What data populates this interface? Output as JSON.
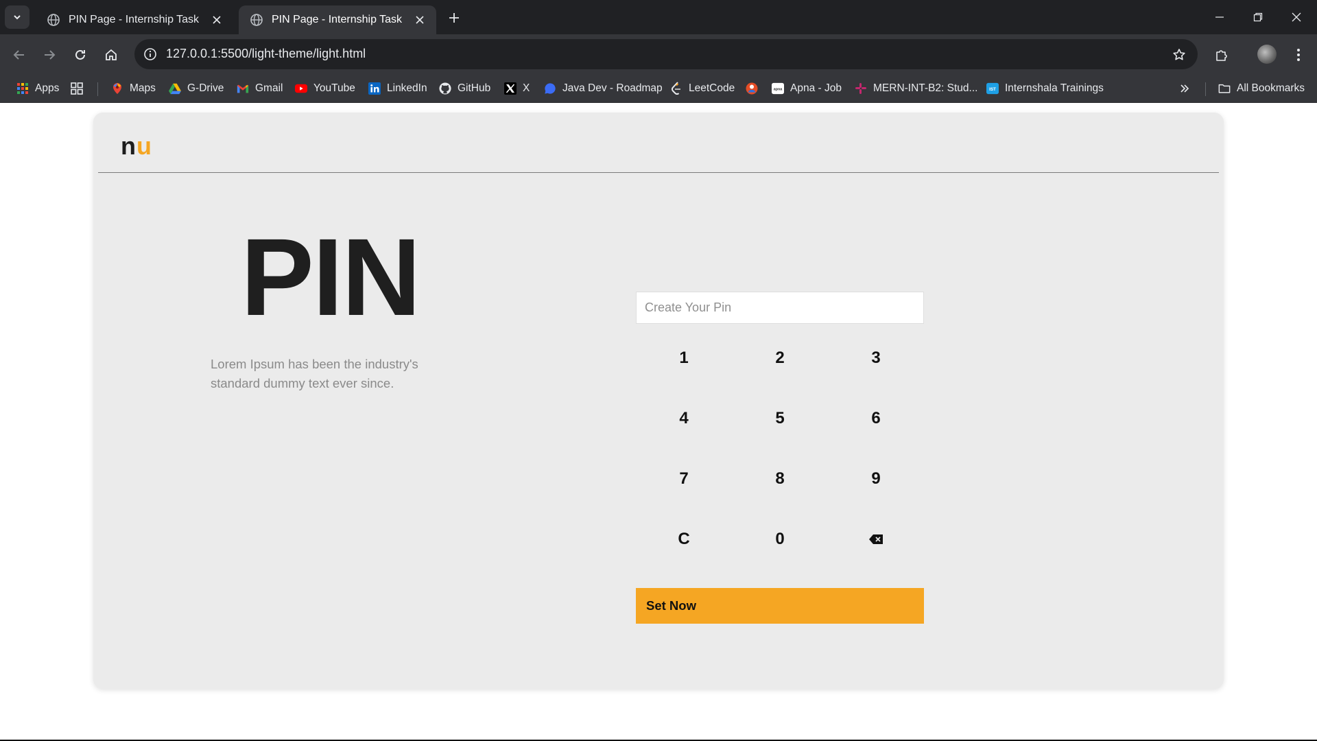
{
  "browser": {
    "tabs": [
      {
        "title": "PIN Page - Internship Task",
        "active": false
      },
      {
        "title": "PIN Page - Internship Task",
        "active": true
      }
    ],
    "address": "127.0.0.1:5500/light-theme/light.html",
    "bookmarks": [
      {
        "label": "Apps",
        "icon": "apps-grid-icon"
      },
      {
        "label": "",
        "icon": "tab-groups-icon"
      },
      {
        "label": "Maps",
        "icon": "maps-pin-icon"
      },
      {
        "label": "G-Drive",
        "icon": "drive-icon"
      },
      {
        "label": "Gmail",
        "icon": "gmail-icon"
      },
      {
        "label": "YouTube",
        "icon": "youtube-icon"
      },
      {
        "label": "LinkedIn",
        "icon": "linkedin-icon"
      },
      {
        "label": "GitHub",
        "icon": "github-icon"
      },
      {
        "label": "X",
        "icon": "x-icon"
      },
      {
        "label": "Java Dev - Roadmap",
        "icon": "chat-bubble-icon"
      },
      {
        "label": "LeetCode",
        "icon": "leetcode-icon"
      },
      {
        "label": "",
        "icon": "profile-badge-icon"
      },
      {
        "label": "Apna - Job",
        "icon": "apna-icon"
      },
      {
        "label": "MERN-INT-B2: Stud...",
        "icon": "slack-icon"
      },
      {
        "label": "Internshala Trainings",
        "icon": "internshala-icon"
      }
    ],
    "all_bookmarks": "All Bookmarks"
  },
  "page": {
    "logo": {
      "part1": "n",
      "part2": "u"
    },
    "heading": "PIN",
    "description": "Lorem Ipsum has been the industry's standard dummy text ever since.",
    "pin_input": {
      "placeholder": "Create Your Pin",
      "value": ""
    },
    "keypad": [
      "1",
      "2",
      "3",
      "4",
      "5",
      "6",
      "7",
      "8",
      "9",
      "C",
      "0",
      "backspace"
    ],
    "submit_label": "Set Now"
  },
  "colors": {
    "accent": "#f5a623",
    "card_background": "#ebebeb",
    "heading": "#1f1f1f",
    "description": "#8a8a8a"
  }
}
